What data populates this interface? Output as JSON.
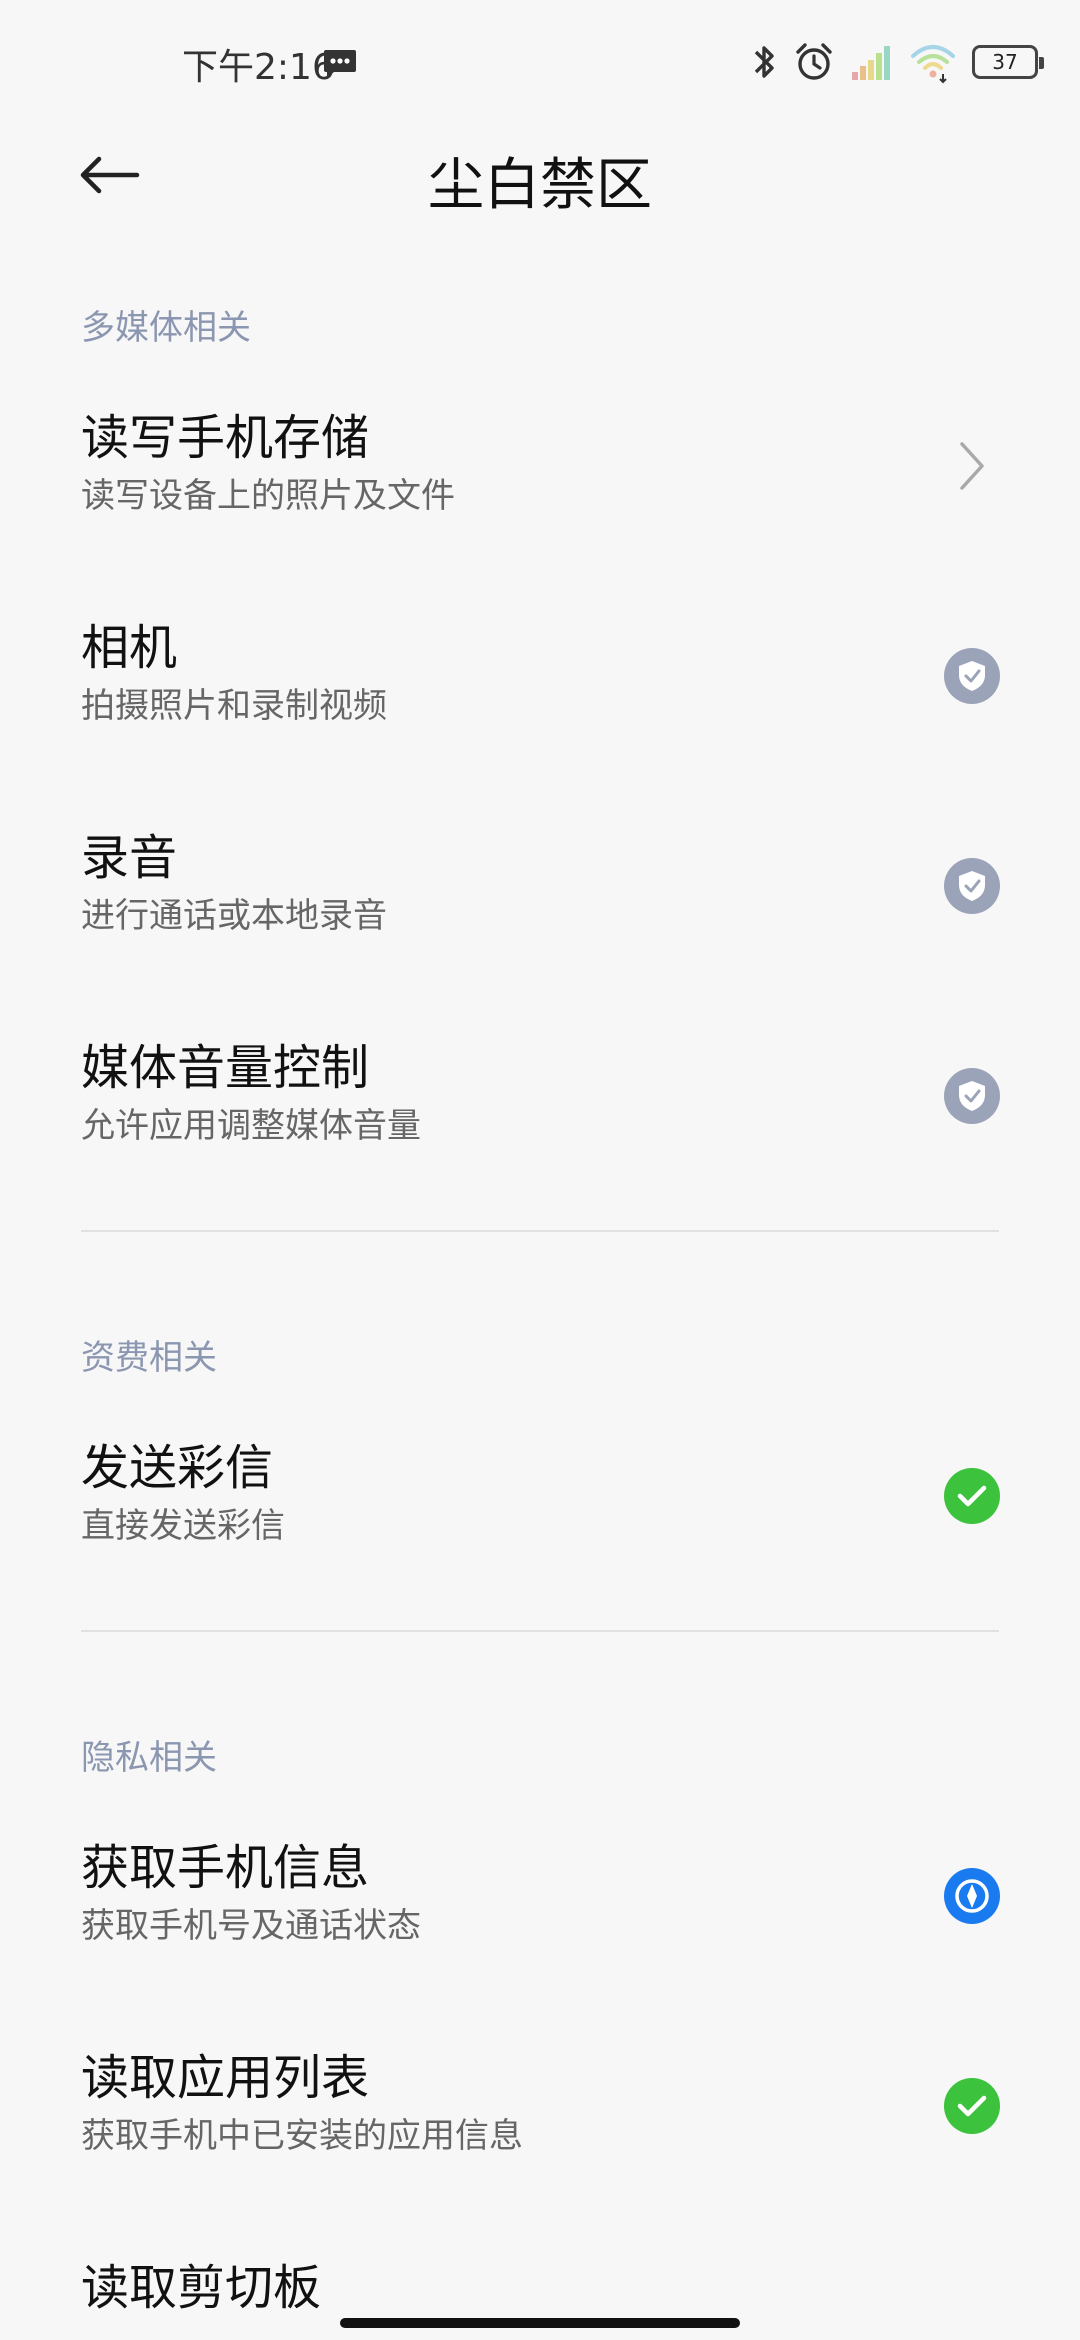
{
  "status_bar": {
    "time": "下午2:16",
    "battery": "37"
  },
  "header": {
    "title": "尘白禁区"
  },
  "sections": [
    {
      "title": "多媒体相关",
      "items": [
        {
          "title": "读写手机存储",
          "desc": "读写设备上的照片及文件",
          "state": "chevron"
        },
        {
          "title": "相机",
          "desc": "拍摄照片和录制视频",
          "state": "ask"
        },
        {
          "title": "录音",
          "desc": "进行通话或本地录音",
          "state": "ask"
        },
        {
          "title": "媒体音量控制",
          "desc": "允许应用调整媒体音量",
          "state": "ask"
        }
      ]
    },
    {
      "title": "资费相关",
      "items": [
        {
          "title": "发送彩信",
          "desc": "直接发送彩信",
          "state": "allowed"
        }
      ]
    },
    {
      "title": "隐私相关",
      "items": [
        {
          "title": "获取手机信息",
          "desc": "获取手机号及通话状态",
          "state": "while_using"
        },
        {
          "title": "读取应用列表",
          "desc": "获取手机中已安装的应用信息",
          "state": "allowed"
        },
        {
          "title": "读取剪切板",
          "desc": "",
          "state": ""
        }
      ]
    }
  ],
  "colors": {
    "ask": "#9aa3b8",
    "allowed": "#3cc23c",
    "while_using": "#1a7bf0",
    "section_title": "#8b96b0"
  },
  "icons": {
    "back": "arrow-left-icon",
    "chevron": "chevron-right-icon",
    "ask": "shield-check-icon",
    "allowed": "check-icon",
    "while_using": "compass-icon"
  }
}
